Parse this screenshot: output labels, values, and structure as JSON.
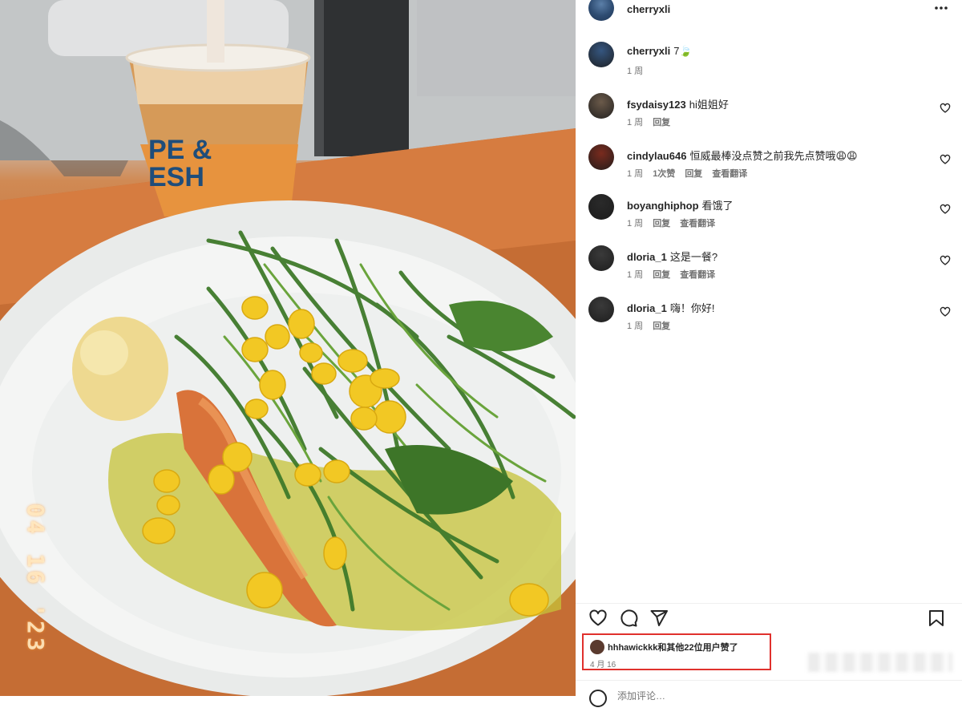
{
  "photo": {
    "cup_text_line1": "PE &",
    "cup_text_line2": "ESH",
    "date_stamp": "04 16 '23"
  },
  "post": {
    "username": "cherryxli"
  },
  "comments": [
    {
      "username": "cherryxli",
      "text": "7🍃",
      "time": "1 周",
      "actions": [],
      "liked": false,
      "avatar_color": "#355680"
    },
    {
      "username": "fsydaisy123",
      "text": "hi姐姐好",
      "time": "1 周",
      "actions": [
        "回复"
      ],
      "liked": true,
      "avatar_color": "#6b5a4a"
    },
    {
      "username": "cindylau646",
      "text": "恒威最棒没点赞之前我先点赞哦😩😩",
      "time": "1 周",
      "actions": [
        "1次赞",
        "回复",
        "查看翻译"
      ],
      "liked": true,
      "avatar_color": "#7a2b1e"
    },
    {
      "username": "boyanghiphop",
      "text": "看饿了",
      "time": "1 周",
      "actions": [
        "回复",
        "查看翻译"
      ],
      "liked": true,
      "avatar_color": "#2a2a2a"
    },
    {
      "username": "dloria_1",
      "text": "这是一餐?",
      "time": "1 周",
      "actions": [
        "回复",
        "查看翻译"
      ],
      "liked": true,
      "avatar_color": "#3a3a3a"
    },
    {
      "username": "dloria_1",
      "text": "嗨！你好!",
      "time": "1 周",
      "actions": [
        "回复"
      ],
      "liked": true,
      "avatar_color": "#3a3a3a"
    }
  ],
  "likes": {
    "text": "hhhawickkk和其他22位用户赞了",
    "date": "4 月 16"
  },
  "add_comment": {
    "placeholder": "添加评论…"
  },
  "icons": {
    "more": "more-horizontal-icon",
    "like": "heart-icon",
    "comment": "comment-icon",
    "share": "share-icon",
    "save": "bookmark-icon",
    "emoji": "emoji-icon"
  }
}
